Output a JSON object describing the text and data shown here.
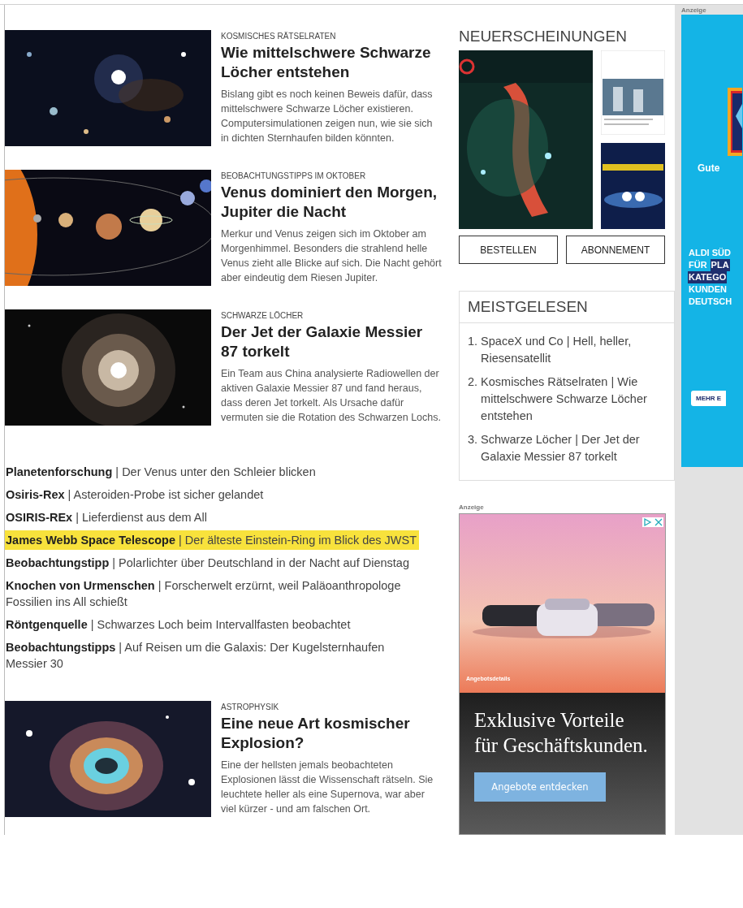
{
  "articles_top": [
    {
      "kicker": "KOSMISCHES RÄTSELRATEN",
      "title": "Wie mittelschwere Schwarze Löcher entstehen",
      "teaser": "Bislang gibt es noch keinen Beweis dafür, dass mittelschwere Schwarze Löcher existieren. Computersimulationen zeigen nun, wie sie sich in dichten Sternhaufen bilden könnten.",
      "kind": "stars"
    },
    {
      "kicker": "BEOBACHTUNGSTIPPS IM OKTOBER",
      "title": "Venus dominiert den Morgen, Jupiter die Nacht",
      "teaser": "Merkur und Venus zeigen sich im Oktober am Morgenhimmel. Besonders die strahlend helle Venus zieht alle Blicke auf sich. Die Nacht gehört aber eindeutig dem Riesen Jupiter.",
      "kind": "planets"
    },
    {
      "kicker": "SCHWARZE LÖCHER",
      "title": "Der Jet der Galaxie Messier 87 torkelt",
      "teaser": "Ein Team aus China analysierte Radiowellen der aktiven Galaxie Messier 87 und fand heraus, dass deren Jet torkelt. Als Ursache dafür vermuten sie die Rotation des Schwarzen Lochs.",
      "kind": "galaxy"
    }
  ],
  "links": [
    {
      "text": "**Planetenforschung** | Der Venus unter den Schleier blicken",
      "highlighted": false
    },
    {
      "text": "**Osiris-Rex** | Asteroiden-Probe ist sicher gelandet",
      "highlighted": false
    },
    {
      "text": "**OSIRIS-REx** | Lieferdienst aus dem All",
      "highlighted": false
    },
    {
      "text": "**James Webb Space Telescope** | Der älteste Einstein-Ring im Blick des JWST",
      "highlighted": true
    },
    {
      "text": "**Beobachtungstipp** | Polarlichter über Deutschland in der Nacht auf Dienstag",
      "highlighted": false
    },
    {
      "text": "**Knochen von Urmenschen** | Forscherwelt erzürnt, weil Paläoanthropologe Fossilien ins All schießt",
      "highlighted": false
    },
    {
      "text": "**Röntgenquelle** | Schwarzes Loch beim Intervallfasten beobachtet",
      "highlighted": false
    },
    {
      "text": "**Beobachtungstipps** | Auf Reisen um die Galaxis: Der Kugelsternhaufen Messier 30",
      "highlighted": false
    }
  ],
  "articles_bottom": [
    {
      "kicker": "ASTROPHYSIK",
      "title": "Eine neue Art kosmischer Explosion?",
      "teaser": "Eine der hellsten jemals beobachteten Explosionen lässt die Wissenschaft rätseln. Sie leuchtete heller als eine Supernova, war aber viel kürzer - und am falschen Ort.",
      "kind": "nebula"
    }
  ],
  "new_releases": {
    "heading": "NEUERSCHEINUNGEN",
    "buttons": [
      "BESTELLEN",
      "ABONNEMENT"
    ]
  },
  "most_read": {
    "heading": "MEISTGELESEN",
    "items": [
      {
        "number": "1.",
        "text": "SpaceX und Co | Hell, heller, Riesensatellit"
      },
      {
        "number": "2.",
        "text": "Kosmisches Rätselraten | Wie mittelschwere Schwarze Löcher entstehen"
      },
      {
        "number": "3.",
        "text": "Schwarze Löcher | Der Jet der Galaxie Messier 87 torkelt"
      }
    ]
  },
  "ad_middle": {
    "label": "Anzeige",
    "caption": "Angebotsdetails",
    "headline": "Exklusive Vorteile für Geschäftskunden.",
    "button": "Angebote entdecken"
  },
  "ad_right": {
    "label": "Anzeige",
    "tagline": "Gute",
    "lines": [
      [
        {
          "text": "ALDI SÜD",
          "highlighted": false
        }
      ],
      [
        {
          "text": "FÜR",
          "highlighted": false
        },
        {
          "text": "PLA",
          "highlighted": true
        }
      ],
      [
        {
          "text": "KATEGO",
          "highlighted": true
        }
      ],
      [
        {
          "text": "KUNDEN",
          "highlighted": false
        }
      ],
      [
        {
          "text": "DEUTSCH",
          "highlighted": false
        }
      ]
    ],
    "button": "MEHR E"
  }
}
